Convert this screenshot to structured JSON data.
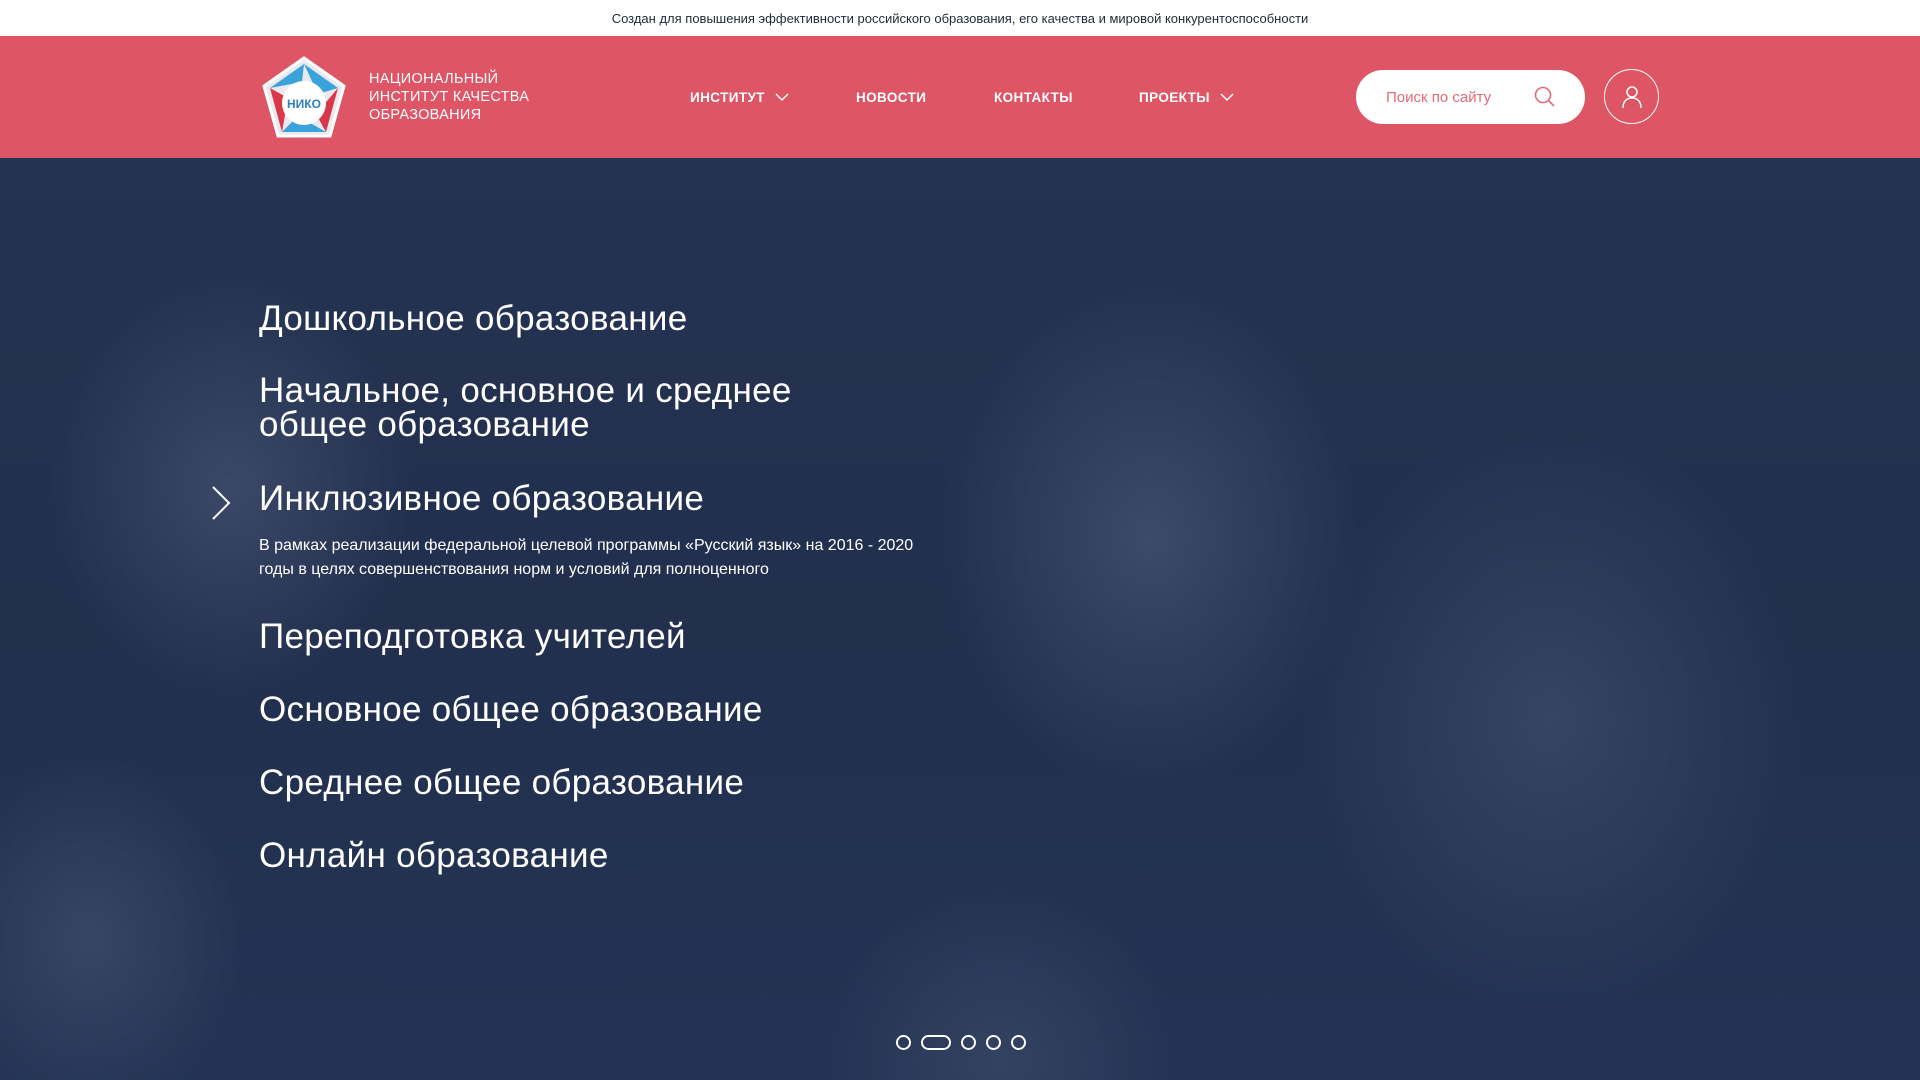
{
  "topbar": {
    "text": "Создан для повышения эффективности российского образования, его качества и мировой конкурентоспособности"
  },
  "brand": {
    "logo_text": "НИКО",
    "name_lines": [
      "НАЦИОНАЛЬНЫЙ",
      "ИНСТИТУТ КАЧЕСТВА",
      "ОБРАЗОВАНИЯ"
    ],
    "header_color": "#de5566"
  },
  "nav": {
    "items": [
      {
        "label": "ИНСТИТУТ",
        "has_dropdown": true
      },
      {
        "label": "НОВОСТИ",
        "has_dropdown": false
      },
      {
        "label": "КОНТАКТЫ",
        "has_dropdown": false
      },
      {
        "label": "ПРОЕКТЫ",
        "has_dropdown": true
      }
    ]
  },
  "search": {
    "placeholder": "Поиск по сайту",
    "value": "",
    "icon": "search-icon"
  },
  "user": {
    "icon": "user-icon"
  },
  "hero": {
    "categories": [
      {
        "label": "Дошкольное образование"
      },
      {
        "label": "Начальное, основное и среднее общее образование"
      },
      {
        "label": "Инклюзивное образование",
        "active": true,
        "description": "В рамках реализации федеральной целевой программы «Русский язык» на 2016 - 2020 годы в целях совершенствования норм и условий для полноценного"
      },
      {
        "label": "Переподготовка учителей"
      },
      {
        "label": "Основное общее образование"
      },
      {
        "label": "Среднее общее образование"
      },
      {
        "label": "Онлайн образование"
      }
    ],
    "slider": {
      "count": 5,
      "active_index": 1
    }
  }
}
